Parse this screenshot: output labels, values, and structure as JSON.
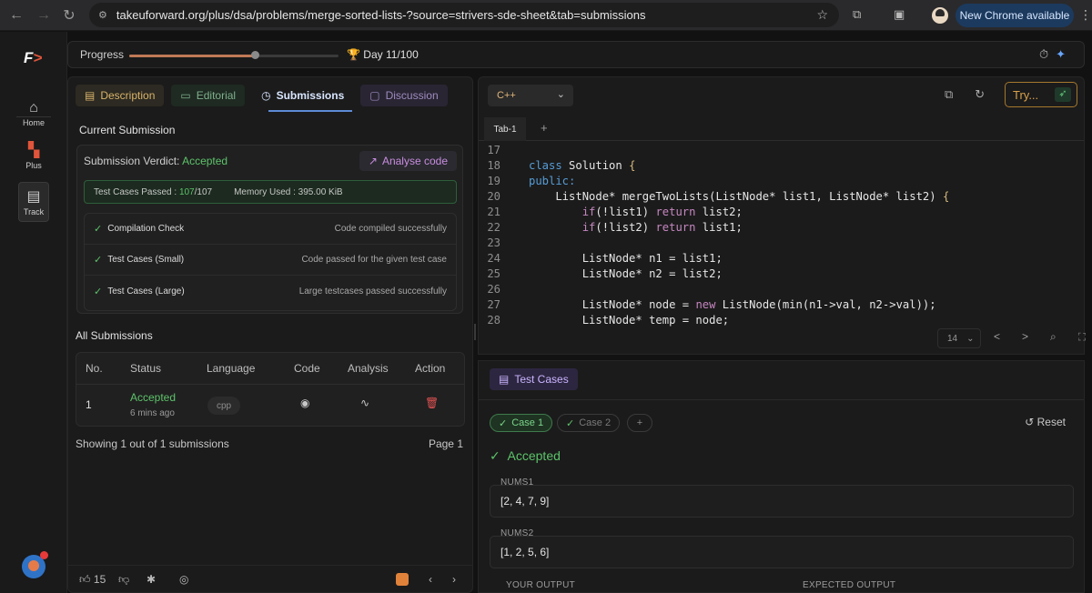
{
  "browser": {
    "url": "takeuforward.org/plus/dsa/problems/merge-sorted-lists-?source=strivers-sde-sheet&tab=submissions",
    "update_label": "New Chrome available"
  },
  "sidebar": {
    "items": [
      {
        "label": "Home",
        "icon": "home-icon"
      },
      {
        "label": "Plus",
        "icon": "plus-icon"
      },
      {
        "label": "Track",
        "icon": "track-icon"
      }
    ]
  },
  "progress": {
    "label": "Progress",
    "fraction": 0.6,
    "day_label": "Day 11/100"
  },
  "left": {
    "tabs": [
      "Description",
      "Editorial",
      "Submissions",
      "Discussion"
    ],
    "current_title": "Current Submission",
    "verdict_label": "Submission Verdict:",
    "verdict_value": "Accepted",
    "analyse_label": "Analyse code",
    "test_cases_label": "Test Cases Passed :",
    "test_cases_passed": "107",
    "test_cases_total": "/107",
    "memory_label": "Memory Used : 395.00 KiB",
    "checks": [
      {
        "name": "Compilation Check",
        "message": "Code compiled successfully"
      },
      {
        "name": "Test Cases (Small)",
        "message": "Code passed for the given test case"
      },
      {
        "name": "Test Cases (Large)",
        "message": "Large testcases passed successfully"
      }
    ],
    "all_title": "All Submissions",
    "table": {
      "headers": [
        "No.",
        "Status",
        "Language",
        "Code",
        "Analysis",
        "Action"
      ],
      "rows": [
        {
          "no": "1",
          "status": "Accepted",
          "time": "6 mins ago",
          "language": "cpp"
        }
      ]
    },
    "showing": "Showing 1 out of 1 submissions",
    "page": "Page 1",
    "likes": "15"
  },
  "editor": {
    "language": "C++",
    "try_label": "Try...",
    "tab": "Tab-1",
    "font_size": "14",
    "lines": [
      {
        "n": "17",
        "t": ""
      },
      {
        "n": "18",
        "t": "class Solution {"
      },
      {
        "n": "19",
        "t": "public:"
      },
      {
        "n": "20",
        "t": "    ListNode* mergeTwoLists(ListNode* list1, ListNode* list2) {"
      },
      {
        "n": "21",
        "t": "        if(!list1) return list2;"
      },
      {
        "n": "22",
        "t": "        if(!list2) return list1;"
      },
      {
        "n": "23",
        "t": ""
      },
      {
        "n": "24",
        "t": "        ListNode* n1 = list1;"
      },
      {
        "n": "25",
        "t": "        ListNode* n2 = list2;"
      },
      {
        "n": "26",
        "t": ""
      },
      {
        "n": "27",
        "t": "        ListNode* node = new ListNode(min(n1->val, n2->val));"
      },
      {
        "n": "28",
        "t": "        ListNode* temp = node;"
      }
    ]
  },
  "testcases": {
    "title": "Test Cases",
    "cases": [
      "Case 1",
      "Case 2"
    ],
    "reset_label": "Reset",
    "result": "Accepted",
    "nums1_label": "NUMS1",
    "nums1": "[2, 4, 7, 9]",
    "nums2_label": "NUMS2",
    "nums2": "[1, 2, 5, 6]",
    "your_output_label": "YOUR OUTPUT",
    "expected_output_label": "EXPECTED OUTPUT"
  }
}
